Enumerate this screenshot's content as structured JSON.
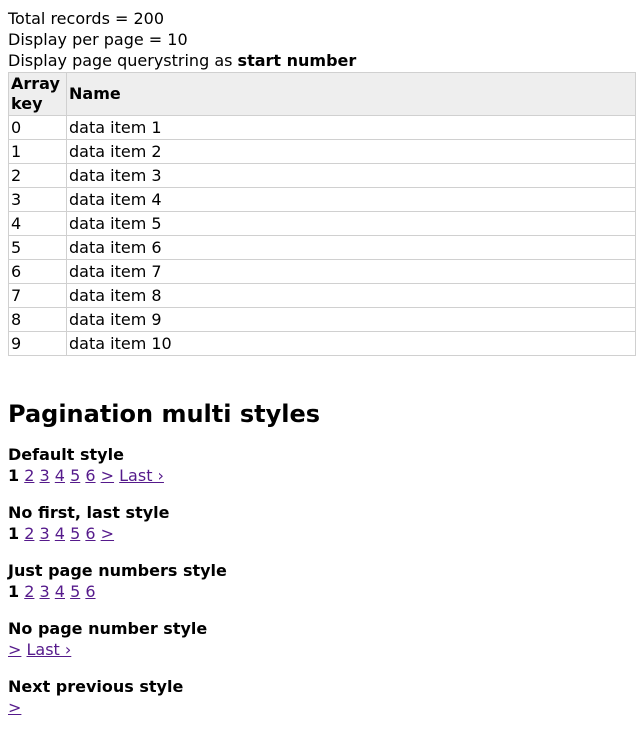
{
  "info": {
    "total_records": "Total records = 200",
    "per_page": "Display per page = 10",
    "querystring_prefix": "Display page querystring as ",
    "querystring_bold": "start number"
  },
  "table": {
    "headers": [
      "Array key",
      "Name"
    ],
    "rows": [
      {
        "key": "0",
        "name": "data item 1"
      },
      {
        "key": "1",
        "name": "data item 2"
      },
      {
        "key": "2",
        "name": "data item 3"
      },
      {
        "key": "3",
        "name": "data item 4"
      },
      {
        "key": "4",
        "name": "data item 5"
      },
      {
        "key": "5",
        "name": "data item 6"
      },
      {
        "key": "6",
        "name": "data item 7"
      },
      {
        "key": "7",
        "name": "data item 8"
      },
      {
        "key": "8",
        "name": "data item 9"
      },
      {
        "key": "9",
        "name": "data item 10"
      }
    ]
  },
  "section_title": "Pagination multi styles",
  "styles": [
    {
      "title": "Default style",
      "items": [
        {
          "text": "1",
          "current": true
        },
        {
          "text": "2"
        },
        {
          "text": "3"
        },
        {
          "text": "4"
        },
        {
          "text": "5"
        },
        {
          "text": "6"
        },
        {
          "text": ">"
        },
        {
          "text": "Last ›"
        }
      ]
    },
    {
      "title": "No first, last style",
      "items": [
        {
          "text": "1",
          "current": true
        },
        {
          "text": "2"
        },
        {
          "text": "3"
        },
        {
          "text": "4"
        },
        {
          "text": "5"
        },
        {
          "text": "6"
        },
        {
          "text": ">"
        }
      ]
    },
    {
      "title": "Just page numbers style",
      "items": [
        {
          "text": "1",
          "current": true
        },
        {
          "text": "2"
        },
        {
          "text": "3"
        },
        {
          "text": "4"
        },
        {
          "text": "5"
        },
        {
          "text": "6"
        }
      ]
    },
    {
      "title": "No page number style",
      "items": [
        {
          "text": ">"
        },
        {
          "text": "Last ›"
        }
      ]
    },
    {
      "title": "Next previous style",
      "items": [
        {
          "text": ">"
        }
      ]
    }
  ],
  "colors": {
    "link": "#551a8b",
    "header_bg": "#eeeeee",
    "border": "#d0d0d0"
  }
}
